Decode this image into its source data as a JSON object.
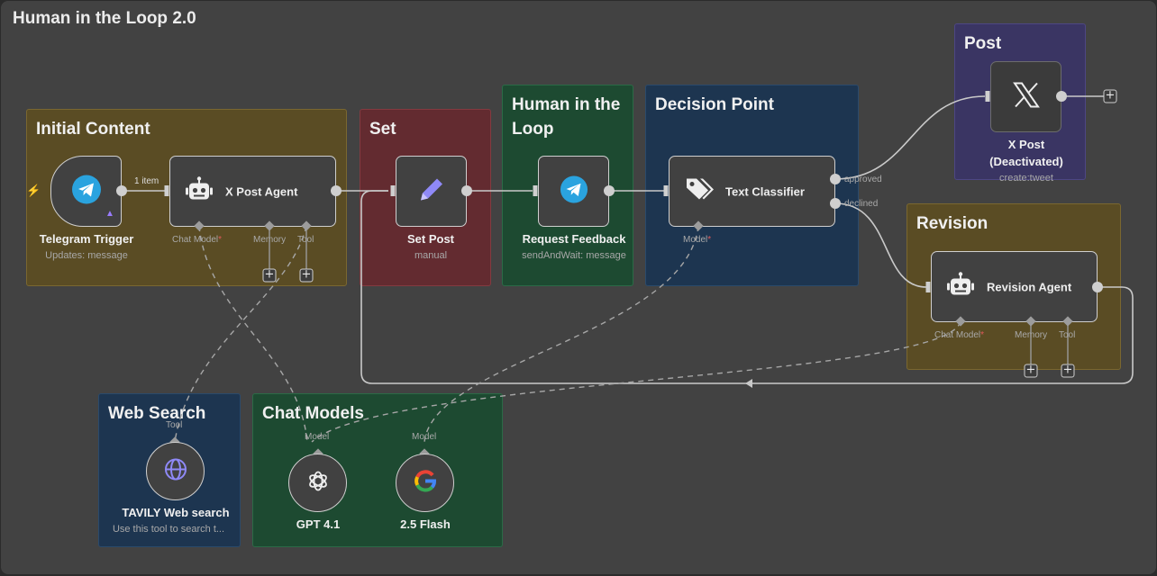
{
  "workflow_title": "Human in the Loop 2.0",
  "groups": {
    "initial_content": "Initial Content",
    "set": "Set",
    "human_in_the_loop": "Human in the Loop",
    "decision_point": "Decision Point",
    "post": "Post",
    "revision": "Revision",
    "web_search": "Web Search",
    "chat_models": "Chat Models"
  },
  "nodes": {
    "telegram_trigger": {
      "label": "Telegram Trigger",
      "subtitle": "Updates: message",
      "icon": "telegram-icon"
    },
    "x_post_agent": {
      "label": "X Post Agent",
      "icon": "robot-icon"
    },
    "set_post": {
      "label": "Set Post",
      "subtitle": "manual",
      "icon": "pencil-icon"
    },
    "request_feedback": {
      "label": "Request Feedback",
      "subtitle": "sendAndWait: message",
      "icon": "telegram-icon"
    },
    "text_classifier": {
      "label": "Text Classifier",
      "icon": "tag-icon"
    },
    "x_post": {
      "label": "X Post",
      "label_2": "(Deactivated)",
      "subtitle": "create:tweet",
      "icon": "x-logo-icon"
    },
    "revision_agent": {
      "label": "Revision Agent",
      "icon": "robot-icon"
    },
    "tavily": {
      "label": "TAVILY Web search",
      "subtitle": "Use this tool to search t...",
      "icon": "globe-icon"
    },
    "gpt41": {
      "label": "GPT 4.1",
      "icon": "openai-icon"
    },
    "flash25": {
      "label": "2.5 Flash",
      "icon": "google-icon"
    }
  },
  "ports": {
    "chat_model": "Chat Model",
    "memory": "Memory",
    "tool": "Tool",
    "model": "Model",
    "approved": "approved",
    "declined": "declined",
    "required_mark": "*"
  },
  "connection_badge": "1 item",
  "plus_symbol": "+",
  "colors": {
    "canvas": "#424242",
    "group_yellow": "#5a4c24",
    "group_red": "#632b30",
    "group_green": "#1d4a31",
    "group_blue": "#1d3550",
    "group_purple": "#3a3563",
    "telegram": "#2aa3df",
    "trigger_bolt": "#ff6d3a",
    "required": "#e05a5a"
  }
}
